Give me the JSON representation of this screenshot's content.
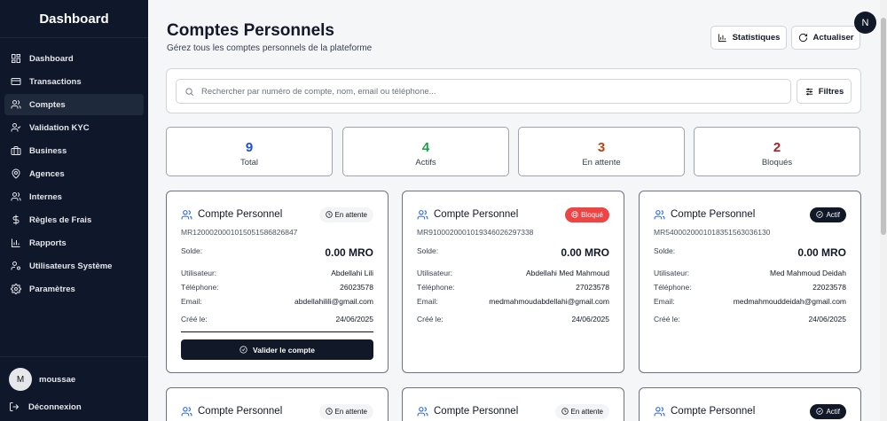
{
  "sidebar": {
    "title": "Dashboard",
    "items": [
      {
        "label": "Dashboard"
      },
      {
        "label": "Transactions"
      },
      {
        "label": "Comptes"
      },
      {
        "label": "Validation KYC"
      },
      {
        "label": "Business"
      },
      {
        "label": "Agences"
      },
      {
        "label": "Internes"
      },
      {
        "label": "Règles de Frais"
      },
      {
        "label": "Rapports"
      },
      {
        "label": "Utilisateurs Système"
      },
      {
        "label": "Paramètres"
      }
    ],
    "user": {
      "initial": "M",
      "name": "moussae"
    },
    "logout": "Déconnexion"
  },
  "header": {
    "title": "Comptes Personnels",
    "subtitle": "Gérez tous les comptes personnels de la plateforme",
    "stats_button": "Statistiques",
    "refresh_button": "Actualiser",
    "user_initial": "N"
  },
  "search": {
    "placeholder": "Rechercher par numéro de compte, nom, email ou téléphone...",
    "filter_button": "Filtres"
  },
  "stats": [
    {
      "value": "9",
      "label": "Total",
      "color": "#1d4ed8"
    },
    {
      "value": "4",
      "label": "Actifs",
      "color": "#16a34a"
    },
    {
      "value": "3",
      "label": "En attente",
      "color": "#c2410c"
    },
    {
      "value": "2",
      "label": "Bloqués",
      "color": "#b91c1c"
    }
  ],
  "labels": {
    "balance": "Solde:",
    "user": "Utilisateur:",
    "phone": "Téléphone:",
    "email": "Email:",
    "created": "Créé le:",
    "validate": "Valider le compte"
  },
  "cards": [
    {
      "title": "Compte Personnel",
      "status": "En attente",
      "number": "MR12000200010150515868​26847",
      "balance": "0.00 MRO",
      "user": "Abdellahi Lili",
      "phone": "26023578",
      "email": "abdellahilili@gmail.com",
      "created": "24/06/2025"
    },
    {
      "title": "Compte Personnel",
      "status": "Bloqué",
      "number": "MR91000200010193460262​97338",
      "balance": "0.00 MRO",
      "user": "Abdellahi Med Mahmoud",
      "phone": "27023578",
      "email": "medmahmoudabdellahi@gmail.com",
      "created": "24/06/2025"
    },
    {
      "title": "Compte Personnel",
      "status": "Actif",
      "number": "MR54000200010183515630​36130",
      "balance": "0.00 MRO",
      "user": "Med Mahmoud Deidah",
      "phone": "22023578",
      "email": "medmahmouddeidah@gmail.com",
      "created": "24/06/2025"
    },
    {
      "title": "Compte Personnel",
      "status": "En attente"
    },
    {
      "title": "Compte Personnel",
      "status": "En attente"
    },
    {
      "title": "Compte Personnel",
      "status": "Actif"
    }
  ]
}
